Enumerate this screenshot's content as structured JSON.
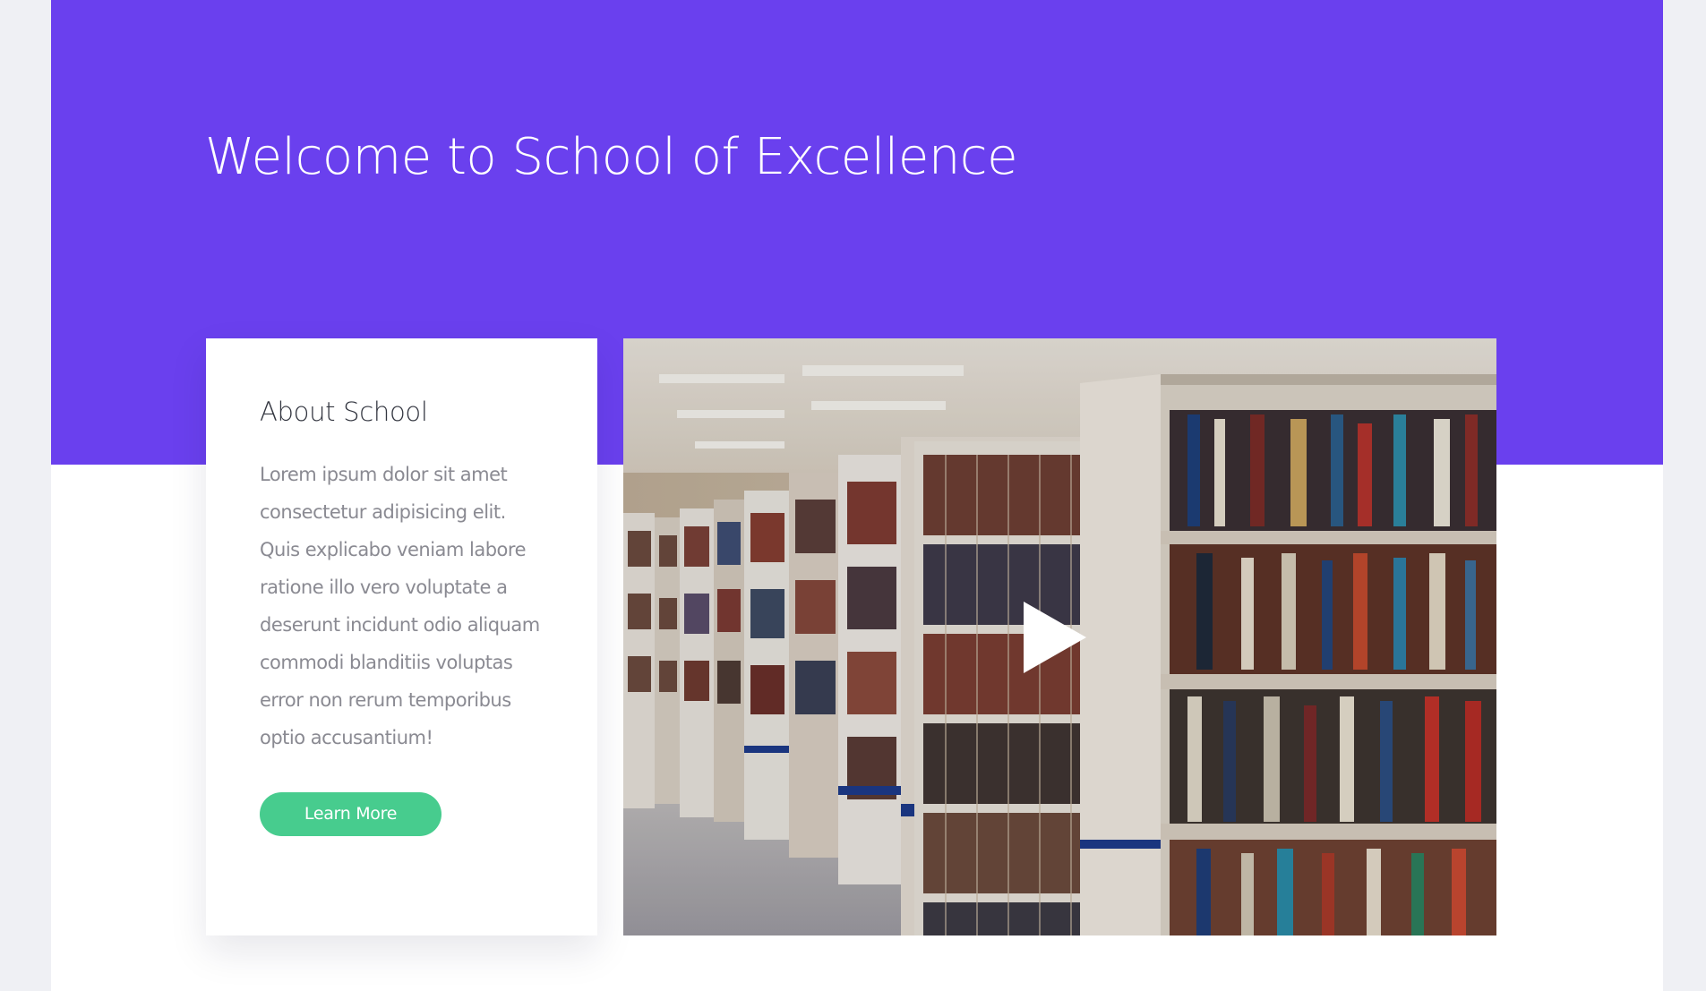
{
  "hero": {
    "title": "Welcome to School of Excellence",
    "background_color": "#6a40ee"
  },
  "about": {
    "title": "About School",
    "text": "Lorem ipsum dolor sit amet consectetur adipisicing elit. Quis explicabo veniam labore ratione illo vero voluptate a deserunt incidunt odio aliquam commodi blanditiis voluptas error non rerum temporibus optio accusantium!",
    "button_label": "Learn More",
    "button_color": "#47cc8e"
  },
  "video": {
    "thumbnail": "library-bookshelves-photo",
    "play_icon": "play-icon"
  }
}
